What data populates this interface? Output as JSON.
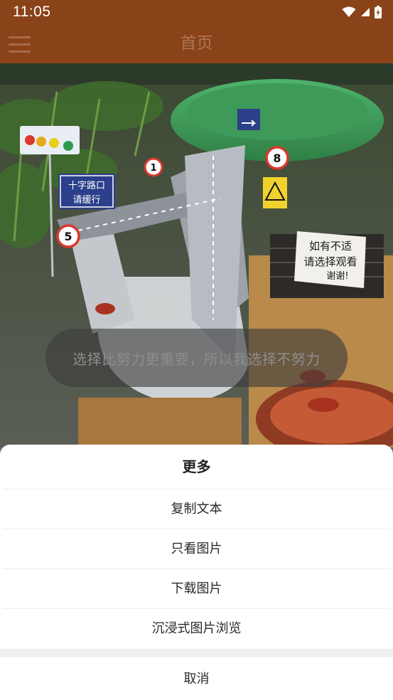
{
  "status_bar": {
    "time": "11:05",
    "icons": [
      "wifi-icon",
      "signal-icon",
      "battery-charging-icon"
    ]
  },
  "app_bar": {
    "title": "首页",
    "menu_icon": "hamburger-menu-icon"
  },
  "photo": {
    "signs": {
      "crossroad_line1": "十字路口",
      "crossroad_line2": "请缓行",
      "hand_sign_line1": "如有不适",
      "hand_sign_line2": "请选择观看",
      "hand_sign_line3": "谢谢!",
      "limit_1": "1",
      "limit_5": "5",
      "limit_8": "8"
    }
  },
  "caption": {
    "text": "选择比努力更重要，所以我选择不努力"
  },
  "sheet": {
    "title": "更多",
    "items": [
      {
        "label": "复制文本"
      },
      {
        "label": "只看图片"
      },
      {
        "label": "下载图片"
      },
      {
        "label": "沉浸式图片浏览"
      }
    ],
    "cancel_label": "取消"
  },
  "colors": {
    "app_bar": "#8a4219",
    "sheet_background": "#ffffff",
    "sheet_gap": "#f0f0f0",
    "overlay_text": "#8d8d8d"
  }
}
